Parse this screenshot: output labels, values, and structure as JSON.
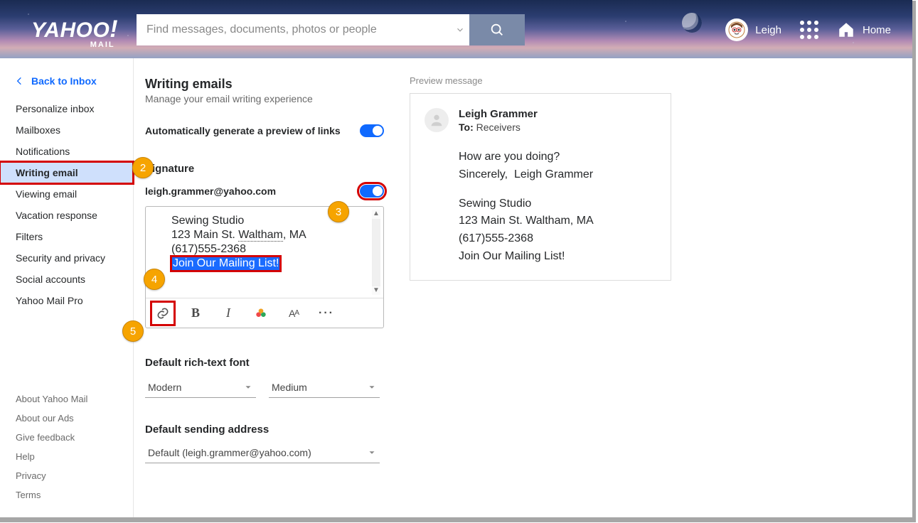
{
  "header": {
    "logo_main": "YAHOO",
    "logo_excl": "!",
    "logo_sub": "MAIL",
    "search_placeholder": "Find messages, documents, photos or people",
    "username": "Leigh",
    "home_label": "Home"
  },
  "sidebar": {
    "back_label": "Back to Inbox",
    "items": [
      "Personalize inbox",
      "Mailboxes",
      "Notifications",
      "Writing email",
      "Viewing email",
      "Vacation response",
      "Filters",
      "Security and privacy",
      "Social accounts",
      "Yahoo Mail Pro"
    ],
    "active_index": 3,
    "footer": [
      "About Yahoo Mail",
      "About our Ads",
      "Give feedback",
      "Help",
      "Privacy",
      "Terms"
    ]
  },
  "settings": {
    "title": "Writing emails",
    "subtitle": "Manage your email writing experience",
    "auto_preview_label": "Automatically generate a preview of links",
    "signature_label": "Signature",
    "signature_email": "leigh.grammer@yahoo.com",
    "signature_lines": {
      "l1": "Sewing Studio",
      "l2_a": "123 Main St. ",
      "l2_b": "Waltham",
      "l2_c": ", MA",
      "l3": "(617)555-2368",
      "l4": "Join Our Mailing List!"
    },
    "rich_font_label": "Default rich-text font",
    "font_family": "Modern",
    "font_size": "Medium",
    "sending_label": "Default sending address",
    "sending_value": "Default (leigh.grammer@yahoo.com)"
  },
  "preview": {
    "heading": "Preview message",
    "from": "Leigh Grammer",
    "to_label": "To:",
    "to_value": "Receivers",
    "body_q": "How are you doing?",
    "body_sig1": "Sincerely,",
    "body_sig2": "Leigh Grammer",
    "sig_l1": "Sewing Studio",
    "sig_l2": "123 Main St. Waltham, MA",
    "sig_l3": "(617)555-2368",
    "sig_l4": "Join Our Mailing List!"
  },
  "annotations": {
    "n2": "2",
    "n3": "3",
    "n4": "4",
    "n5": "5"
  }
}
